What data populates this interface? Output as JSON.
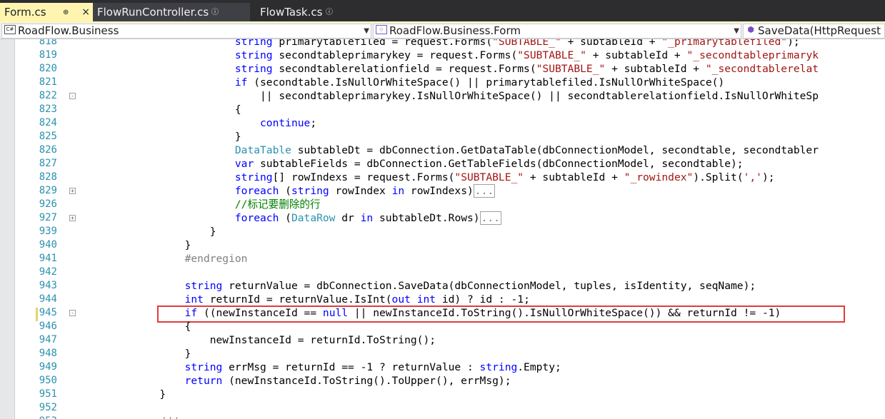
{
  "tabs": [
    {
      "title": "Form.cs",
      "pin": "⊕",
      "close": "×",
      "active": true
    },
    {
      "title": "FlowRunController.cs",
      "pin": "ⓘ"
    },
    {
      "title": "FlowTask.cs",
      "pin": "ⓘ"
    }
  ],
  "navbar": {
    "project": "RoadFlow.Business",
    "project_icon": "C#",
    "type": "RoadFlow.Business.Form",
    "member": "SaveData(HttpRequest r"
  },
  "colors": {
    "keyword": "#0000ff",
    "type": "#2b91af",
    "string": "#a31515",
    "comment": "#008000",
    "highlight_box": "#e03b3b",
    "active_tab": "#fff5b1"
  },
  "editor": {
    "lines": [
      {
        "n": "818",
        "fold": "",
        "segs": [
          [
            "",
            "                        "
          ],
          [
            "kw",
            "string"
          ],
          [
            "",
            " primarytablefiled = request.Forms("
          ],
          [
            "str",
            "\"SUBTABLE_\""
          ],
          [
            "",
            " + subtableId + "
          ],
          [
            "str",
            "\"_primarytablefiled\""
          ],
          [
            "",
            ");"
          ]
        ]
      },
      {
        "n": "819",
        "fold": "",
        "segs": [
          [
            "",
            "                        "
          ],
          [
            "kw",
            "string"
          ],
          [
            "",
            " secondtableprimarykey = request.Forms("
          ],
          [
            "str",
            "\"SUBTABLE_\""
          ],
          [
            "",
            " + subtableId + "
          ],
          [
            "str",
            "\"_secondtableprimaryk"
          ]
        ]
      },
      {
        "n": "820",
        "fold": "",
        "segs": [
          [
            "",
            "                        "
          ],
          [
            "kw",
            "string"
          ],
          [
            "",
            " secondtablerelationfield = request.Forms("
          ],
          [
            "str",
            "\"SUBTABLE_\""
          ],
          [
            "",
            " + subtableId + "
          ],
          [
            "str",
            "\"_secondtablerelat"
          ]
        ]
      },
      {
        "n": "821",
        "fold": "",
        "segs": [
          [
            "",
            "                        "
          ],
          [
            "kw",
            "if"
          ],
          [
            "",
            " (secondtable.IsNullOrWhiteSpace() || primarytablefiled.IsNullOrWhiteSpace()"
          ]
        ]
      },
      {
        "n": "822",
        "fold": "-",
        "segs": [
          [
            "",
            "                            || secondtableprimarykey.IsNullOrWhiteSpace() || secondtablerelationfield.IsNullOrWhiteSp"
          ]
        ]
      },
      {
        "n": "823",
        "fold": "",
        "segs": [
          [
            "",
            "                        {"
          ]
        ]
      },
      {
        "n": "824",
        "fold": "",
        "segs": [
          [
            "",
            "                            "
          ],
          [
            "kw",
            "continue"
          ],
          [
            "",
            ";"
          ]
        ]
      },
      {
        "n": "825",
        "fold": "",
        "segs": [
          [
            "",
            "                        }"
          ]
        ]
      },
      {
        "n": "826",
        "fold": "",
        "segs": [
          [
            "",
            "                        "
          ],
          [
            "ty",
            "DataTable"
          ],
          [
            "",
            " subtableDt = dbConnection.GetDataTable(dbConnectionModel, secondtable, secondtabler"
          ]
        ]
      },
      {
        "n": "827",
        "fold": "",
        "segs": [
          [
            "",
            "                        "
          ],
          [
            "kw",
            "var"
          ],
          [
            "",
            " subtableFields = dbConnection.GetTableFields(dbConnectionModel, secondtable);"
          ]
        ]
      },
      {
        "n": "828",
        "fold": "",
        "segs": [
          [
            "",
            "                        "
          ],
          [
            "kw",
            "string"
          ],
          [
            "",
            "[] rowIndexs = request.Forms("
          ],
          [
            "str",
            "\"SUBTABLE_\""
          ],
          [
            "",
            " + subtableId + "
          ],
          [
            "str",
            "\"_rowindex\""
          ],
          [
            "",
            ").Split("
          ],
          [
            "str",
            "','"
          ],
          [
            "",
            ");"
          ]
        ]
      },
      {
        "n": "829",
        "fold": "+",
        "segs": [
          [
            "",
            "                        "
          ],
          [
            "kw",
            "foreach"
          ],
          [
            "",
            " ("
          ],
          [
            "kw",
            "string"
          ],
          [
            "",
            " rowIndex "
          ],
          [
            "kw",
            "in"
          ],
          [
            "",
            " rowIndexs)"
          ],
          [
            "coll",
            "..."
          ]
        ]
      },
      {
        "n": "926",
        "fold": "",
        "segs": [
          [
            "",
            "                        "
          ],
          [
            "cm",
            "//标记要删除的行"
          ]
        ]
      },
      {
        "n": "927",
        "fold": "+",
        "segs": [
          [
            "",
            "                        "
          ],
          [
            "kw",
            "foreach"
          ],
          [
            "",
            " ("
          ],
          [
            "ty",
            "DataRow"
          ],
          [
            "",
            " dr "
          ],
          [
            "kw",
            "in"
          ],
          [
            "",
            " subtableDt.Rows)"
          ],
          [
            "coll",
            "..."
          ]
        ]
      },
      {
        "n": "939",
        "fold": "",
        "segs": [
          [
            "",
            "                    }"
          ]
        ]
      },
      {
        "n": "940",
        "fold": "",
        "segs": [
          [
            "",
            "                }"
          ]
        ]
      },
      {
        "n": "941",
        "fold": "",
        "segs": [
          [
            "",
            "                "
          ],
          [
            "pp",
            "#endregion"
          ]
        ]
      },
      {
        "n": "942",
        "fold": "",
        "segs": [
          [
            "",
            ""
          ]
        ]
      },
      {
        "n": "943",
        "fold": "",
        "segs": [
          [
            "",
            "                "
          ],
          [
            "kw",
            "string"
          ],
          [
            "",
            " returnValue = dbConnection.SaveData(dbConnectionModel, tuples, isIdentity, seqName);"
          ]
        ]
      },
      {
        "n": "944",
        "fold": "",
        "segs": [
          [
            "",
            "                "
          ],
          [
            "kw",
            "int"
          ],
          [
            "",
            " returnId = returnValue.IsInt("
          ],
          [
            "kw",
            "out"
          ],
          [
            "",
            " "
          ],
          [
            "kw",
            "int"
          ],
          [
            "",
            " id) ? id : -1;"
          ]
        ]
      },
      {
        "n": "945",
        "fold": "-",
        "segs": [
          [
            "",
            "                "
          ],
          [
            "kw",
            "if"
          ],
          [
            "",
            " ((newInstanceId == "
          ],
          [
            "kw",
            "null"
          ],
          [
            "",
            " || newInstanceId.ToString().IsNullOrWhiteSpace()) && returnId != -1)"
          ]
        ]
      },
      {
        "n": "946",
        "fold": "",
        "segs": [
          [
            "",
            "                {"
          ]
        ]
      },
      {
        "n": "947",
        "fold": "",
        "segs": [
          [
            "",
            "                    newInstanceId = returnId.ToString();"
          ]
        ]
      },
      {
        "n": "948",
        "fold": "",
        "segs": [
          [
            "",
            "                }"
          ]
        ]
      },
      {
        "n": "949",
        "fold": "",
        "segs": [
          [
            "",
            "                "
          ],
          [
            "kw",
            "string"
          ],
          [
            "",
            " errMsg = returnId == -1 ? returnValue : "
          ],
          [
            "kw",
            "string"
          ],
          [
            "",
            ".Empty;"
          ]
        ]
      },
      {
        "n": "950",
        "fold": "",
        "segs": [
          [
            "",
            "                "
          ],
          [
            "kw",
            "return"
          ],
          [
            "",
            " (newInstanceId.ToString().ToUpper(), errMsg);"
          ]
        ]
      },
      {
        "n": "951",
        "fold": "",
        "segs": [
          [
            "",
            "            }"
          ]
        ]
      },
      {
        "n": "952",
        "fold": "",
        "segs": [
          [
            "",
            ""
          ]
        ]
      },
      {
        "n": "953",
        "fold": "",
        "segs": [
          [
            "",
            "            "
          ],
          [
            "pp",
            "///"
          ]
        ]
      }
    ]
  }
}
